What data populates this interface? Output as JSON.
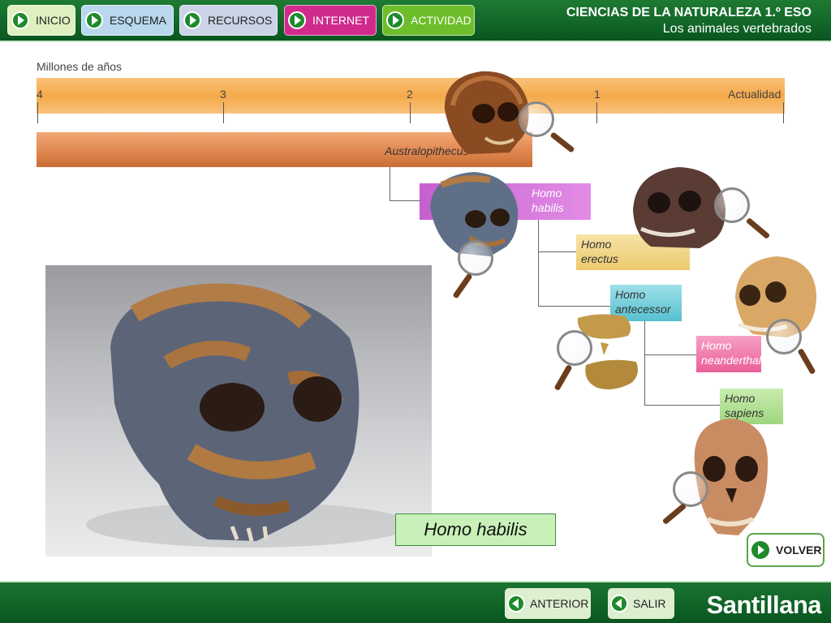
{
  "nav": {
    "inicio": "INICIO",
    "esquema": "ESQUEMA",
    "recursos": "RECURSOS",
    "internet": "INTERNET",
    "actividad": "ACTIVIDAD"
  },
  "header": {
    "title": "CIENCIAS DE LA NATURALEZA 1.º ESO",
    "subtitle": "Los animales vertebrados"
  },
  "timeline": {
    "axis_label": "Millones de años",
    "ticks": [
      "4",
      "3",
      "2",
      "1",
      "Actualidad"
    ],
    "austral_label": "Australopithecus"
  },
  "species": {
    "habilis": [
      "Homo",
      "habilis"
    ],
    "erectus": [
      "Homo",
      "erectus"
    ],
    "antecessor": [
      "Homo",
      "antecessor"
    ],
    "neanderthalensis": [
      "Homo",
      "neanderthalensis"
    ],
    "sapiens": [
      "Homo",
      "sapiens"
    ]
  },
  "photo": {
    "caption": "Homo habilis"
  },
  "buttons": {
    "volver": "VOLVER",
    "anterior": "ANTERIOR",
    "salir": "SALIR"
  },
  "brand": {
    "logo": "Santillana"
  },
  "colors": {
    "topbar": "#0f6226",
    "internet": "#d02b8c",
    "actividad": "#6ebd2b",
    "timebar": "#f4a94a",
    "australopithecus": "#e0874f"
  }
}
